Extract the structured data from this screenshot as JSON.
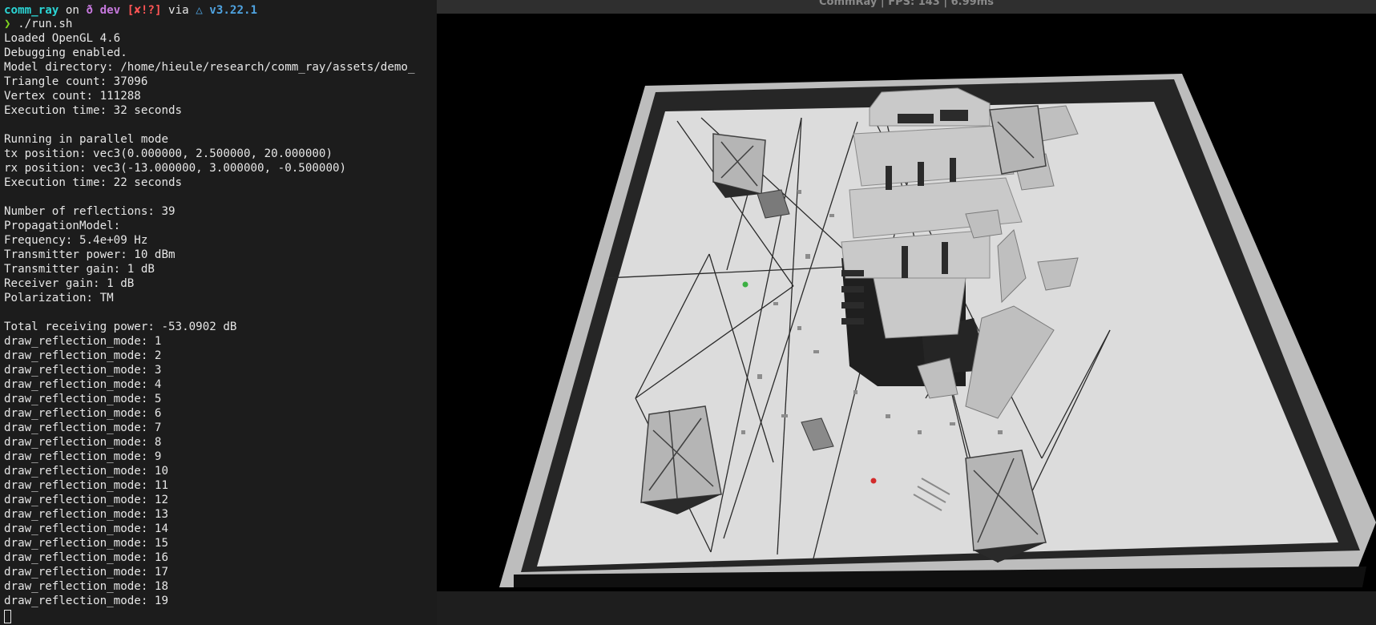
{
  "terminal": {
    "prompt": {
      "dir": "comm_ray",
      "on": " on ",
      "branch": "ð dev",
      "status": "[✘!?]",
      "via": " via ",
      "version": "△ v3.22.1",
      "arrow": "❯",
      "command": " ./run.sh"
    },
    "lines": [
      "Loaded OpenGL 4.6",
      "Debugging enabled.",
      "Model directory: /home/hieule/research/comm_ray/assets/demo_",
      "Triangle count: 37096",
      "Vertex count: 111288",
      "Execution time: 32 seconds",
      "",
      "Running in parallel mode",
      "tx position: vec3(0.000000, 2.500000, 20.000000)",
      "rx position: vec3(-13.000000, 3.000000, -0.500000)",
      "Execution time: 22 seconds",
      "",
      "Number of reflections: 39",
      "PropagationModel:",
      "Frequency: 5.4e+09 Hz",
      "Transmitter power: 10 dBm",
      "Transmitter gain: 1 dB",
      "Receiver gain: 1 dB",
      "Polarization: TM",
      "",
      "Total receiving power: -53.0902 dB",
      "draw_reflection_mode: 1",
      "draw_reflection_mode: 2",
      "draw_reflection_mode: 3",
      "draw_reflection_mode: 4",
      "draw_reflection_mode: 5",
      "draw_reflection_mode: 6",
      "draw_reflection_mode: 7",
      "draw_reflection_mode: 8",
      "draw_reflection_mode: 9",
      "draw_reflection_mode: 10",
      "draw_reflection_mode: 11",
      "draw_reflection_mode: 12",
      "draw_reflection_mode: 13",
      "draw_reflection_mode: 14",
      "draw_reflection_mode: 15",
      "draw_reflection_mode: 16",
      "draw_reflection_mode: 17",
      "draw_reflection_mode: 18",
      "draw_reflection_mode: 19"
    ]
  },
  "window": {
    "title": "CommRay | FPS: 143 | 6.99ms"
  },
  "scene": {
    "tx_marker_color": "#3cb043",
    "rx_marker_color": "#d22b2b",
    "floor_color": "#dcdcdc",
    "wall_color": "#bcbcbc",
    "ray_color": "#2a2a2a"
  }
}
